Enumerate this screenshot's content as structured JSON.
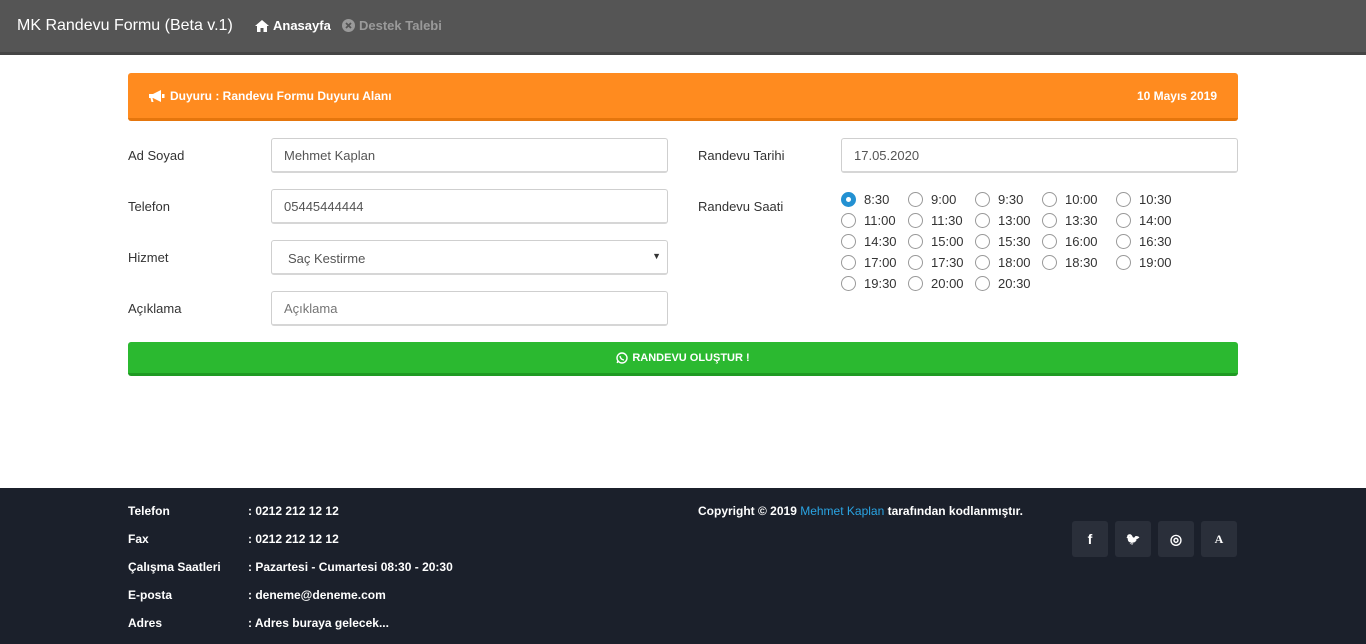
{
  "navbar": {
    "brand": "MK Randevu Formu (Beta v.1)",
    "home_label": "Anasayfa",
    "support_label": "Destek Talebi"
  },
  "announcement": {
    "text": "Duyuru : Randevu Formu Duyuru Alanı",
    "date": "10 Mayıs 2019"
  },
  "form": {
    "name_label": "Ad Soyad",
    "name_value": "Mehmet Kaplan",
    "phone_label": "Telefon",
    "phone_value": "05445444444",
    "service_label": "Hizmet",
    "service_value": "Saç Kestirme",
    "note_label": "Açıklama",
    "note_placeholder": "Açıklama",
    "date_label": "Randevu Tarihi",
    "date_value": "17.05.2020",
    "time_label": "Randevu Saati",
    "times": [
      "8:30",
      "9:00",
      "9:30",
      "10:00",
      "10:30",
      "11:00",
      "11:30",
      "13:00",
      "13:30",
      "14:00",
      "14:30",
      "15:00",
      "15:30",
      "16:00",
      "16:30",
      "17:00",
      "17:30",
      "18:00",
      "18:30",
      "19:00",
      "19:30",
      "20:00",
      "20:30"
    ],
    "selected_time": "8:30",
    "submit_label": "RANDEVU OLUŞTUR !"
  },
  "footer": {
    "rows": [
      {
        "label": "Telefon",
        "value": ": 0212 212 12 12"
      },
      {
        "label": "Fax",
        "value": ": 0212 212 12 12"
      },
      {
        "label": "Çalışma Saatleri",
        "value": ": Pazartesi - Cumartesi 08:30 - 20:30"
      },
      {
        "label": "E-posta",
        "value": ": deneme@deneme.com"
      },
      {
        "label": "Adres",
        "value": ": Adres buraya gelecek..."
      }
    ],
    "copyright_prefix": "Copyright © 2019 ",
    "copyright_author": "Mehmet Kaplan",
    "copyright_suffix": " tarafından kodlanmıştır.",
    "social": [
      {
        "icon": "facebook-icon",
        "glyph": "f"
      },
      {
        "icon": "twitter-icon",
        "glyph": "🐦"
      },
      {
        "icon": "instagram-icon",
        "glyph": "◎"
      },
      {
        "icon": "font-icon",
        "glyph": "A"
      }
    ]
  },
  "colors": {
    "navbar": "#555555",
    "announcement": "#ff8b1f",
    "submit": "#2bb930",
    "footer": "#1b202b",
    "link": "#2aa4e3",
    "radio_checked": "#2391d2"
  }
}
